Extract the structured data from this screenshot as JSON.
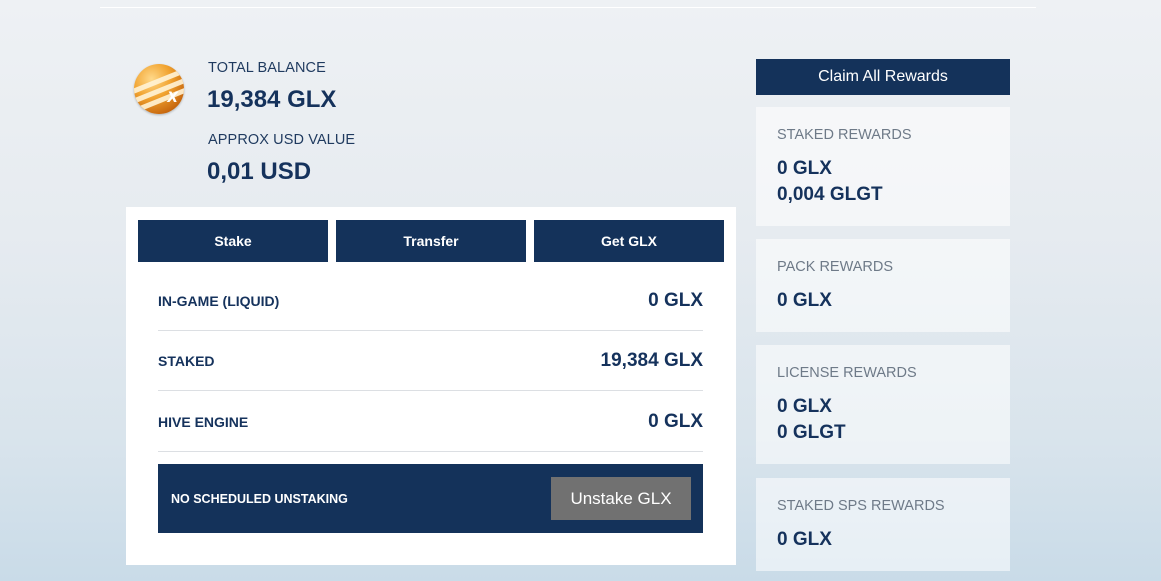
{
  "balance": {
    "icon": "glx-coin-icon",
    "total_label": "TOTAL BALANCE",
    "total_value": "19,384 GLX",
    "usd_label": "APPROX USD VALUE",
    "usd_value": "0,01 USD"
  },
  "actions": {
    "stake": "Stake",
    "transfer": "Transfer",
    "get_glx": "Get GLX"
  },
  "holdings": [
    {
      "label": "IN-GAME (LIQUID)",
      "value": "0 GLX"
    },
    {
      "label": "STAKED",
      "value": "19,384 GLX"
    },
    {
      "label": "HIVE ENGINE",
      "value": "0 GLX"
    }
  ],
  "unstaking": {
    "status": "NO SCHEDULED UNSTAKING",
    "button": "Unstake GLX"
  },
  "rewards": {
    "claim_all": "Claim All Rewards",
    "boxes": [
      {
        "title": "STAKED REWARDS",
        "amounts": [
          "0 GLX",
          "0,004 GLGT"
        ]
      },
      {
        "title": "PACK REWARDS",
        "amounts": [
          "0 GLX"
        ]
      },
      {
        "title": "LICENSE REWARDS",
        "amounts": [
          "0 GLX",
          "0 GLGT"
        ]
      },
      {
        "title": "STAKED SPS REWARDS",
        "amounts": [
          "0 GLX"
        ]
      }
    ]
  },
  "colors": {
    "navy": "#14325a",
    "text": "#15325c",
    "muted": "#6e7a88",
    "unstake_button": "#717171"
  }
}
